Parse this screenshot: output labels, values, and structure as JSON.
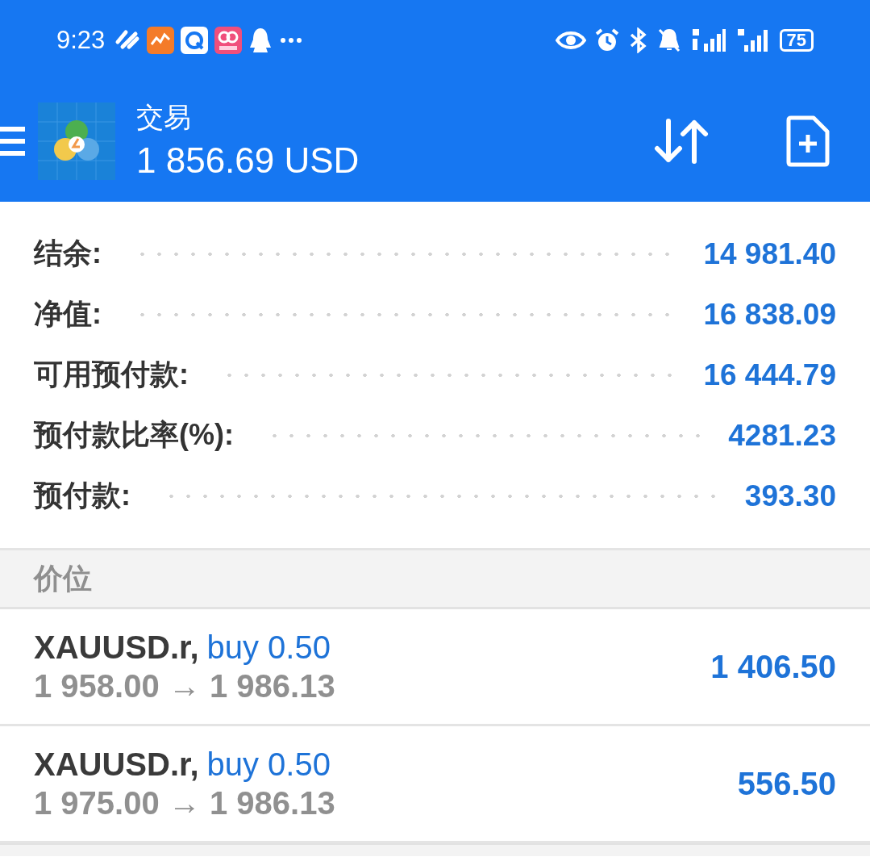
{
  "status_bar": {
    "time": "9:23",
    "battery": "75"
  },
  "app_bar": {
    "title": "交易",
    "balance": "1 856.69 USD"
  },
  "summary": [
    {
      "label": "结余:",
      "value": "14 981.40"
    },
    {
      "label": "净值:",
      "value": "16 838.09"
    },
    {
      "label": "可用预付款:",
      "value": "16 444.79"
    },
    {
      "label": "预付款比率(%):",
      "value": "4281.23"
    },
    {
      "label": "预付款:",
      "value": "393.30"
    }
  ],
  "section": {
    "title": "价位"
  },
  "positions": [
    {
      "symbol": "XAUUSD.r,",
      "side": "buy 0.50",
      "prices": "1 958.00 → 1 986.13",
      "profit": "1 406.50"
    },
    {
      "symbol": "XAUUSD.r,",
      "side": "buy 0.50",
      "prices": "1 975.00 → 1 986.13",
      "profit": "556.50"
    }
  ]
}
